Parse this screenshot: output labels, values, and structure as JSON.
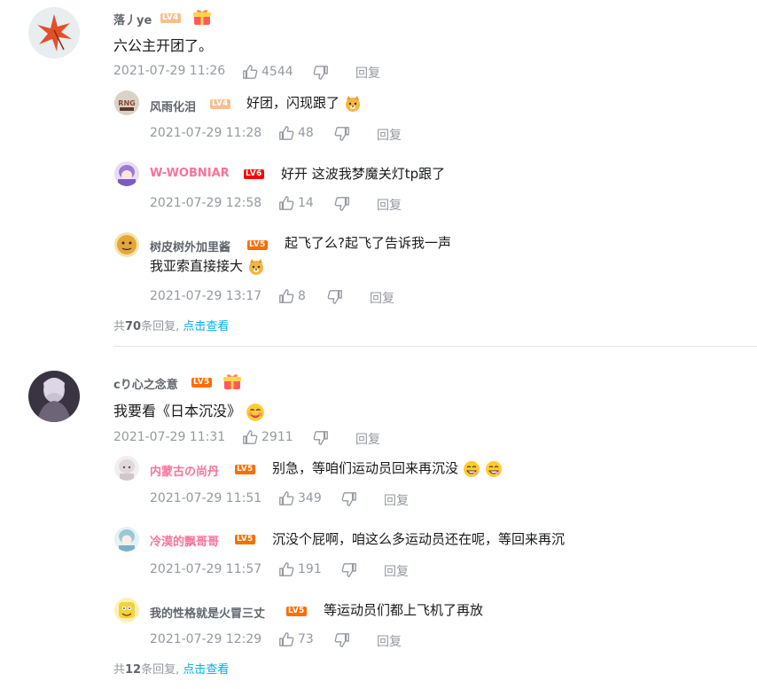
{
  "comments": [
    {
      "user": "落丿ye",
      "level": "LV4",
      "text": "六公主开团了。",
      "time": "2021-07-29 11:26",
      "likes": "4544",
      "reply_label": "回复",
      "replies": [
        {
          "user": "风雨化泪",
          "level": "LV4",
          "text": "好团，闪现跟了",
          "time": "2021-07-29 11:28",
          "likes": "48",
          "reply_label": "回复"
        },
        {
          "user": "W-WOBNIAR",
          "level": "LV6",
          "text": "好开 这波我梦魔关灯tp跟了",
          "time": "2021-07-29 12:58",
          "likes": "14",
          "reply_label": "回复"
        },
        {
          "user": "树皮树外加里酱",
          "level": "LV5",
          "text_line1": "起飞了么?起飞了告诉我一声",
          "text_line2": "我亚索直接接大",
          "time": "2021-07-29 13:17",
          "likes": "8",
          "reply_label": "回复"
        }
      ],
      "summary_prefix": "共",
      "summary_count": "70",
      "summary_suffix": "条回复,",
      "summary_link": "点击查看"
    },
    {
      "user": "cり心之念意",
      "level": "LV5",
      "text": "我要看《日本沉没》",
      "time": "2021-07-29 11:31",
      "likes": "2911",
      "reply_label": "回复",
      "replies": [
        {
          "user": "内蒙古の尚丹",
          "level": "LV5",
          "text": "别急，等咱们运动员回来再沉没",
          "time": "2021-07-29 11:51",
          "likes": "349",
          "reply_label": "回复"
        },
        {
          "user": "冷漠的飘哥哥",
          "level": "LV5",
          "text": "沉没个屁啊，咱这么多运动员还在呢，等回来再沉",
          "time": "2021-07-29 11:57",
          "likes": "191",
          "reply_label": "回复"
        },
        {
          "user": "我的性格就是火冒三丈",
          "level": "LV5",
          "text": "等运动员们都上飞机了再放",
          "time": "2021-07-29 12:29",
          "likes": "73",
          "reply_label": "回复"
        }
      ],
      "summary_prefix": "共",
      "summary_count": "12",
      "summary_suffix": "条回复,",
      "summary_link": "点击查看"
    }
  ],
  "colors": {
    "pink_name": "#fb7299",
    "gray_text": "#9499a0",
    "link": "#00aeec",
    "lv4": "#f7c08b",
    "lv5": "#ff6c00",
    "lv6": "#ff0000"
  },
  "icons": {
    "like": "thumbs-up-icon",
    "dislike": "thumbs-down-icon",
    "badge": "gift-badge-icon"
  }
}
